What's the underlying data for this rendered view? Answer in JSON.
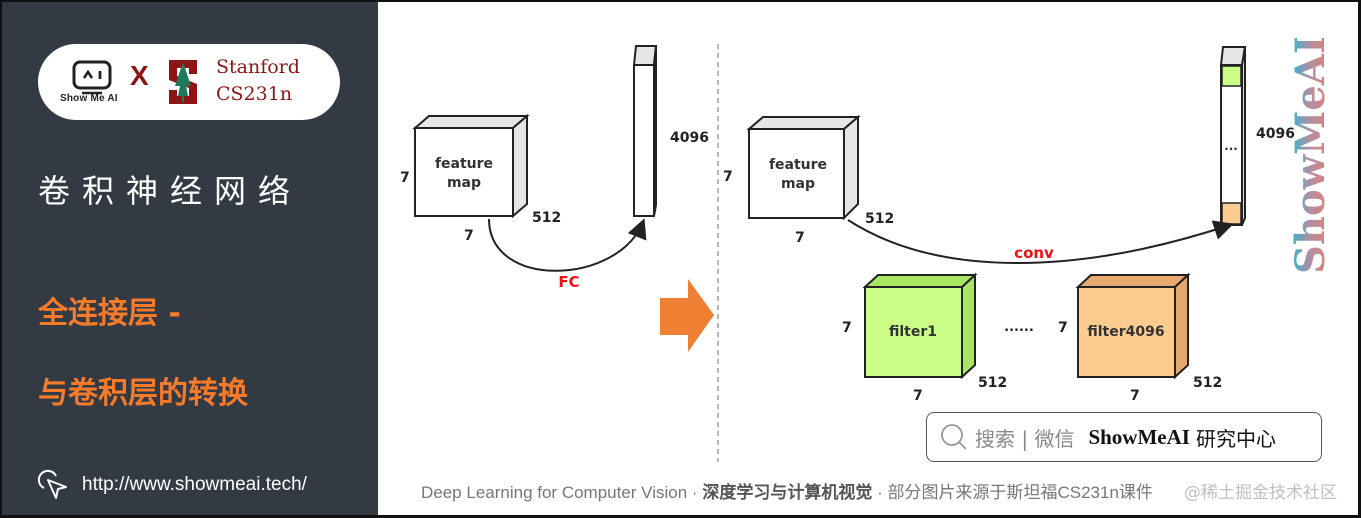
{
  "brand": {
    "showmeai_label": "Show Me AI",
    "cross": "X",
    "partner_line1": "Stanford",
    "partner_line2": "CS231n",
    "colors": {
      "stanford_red": "#8c1515",
      "panel_bg": "#333a44",
      "accent_orange": "#f47b2a"
    }
  },
  "left_panel": {
    "course_title": "卷积神经网络",
    "topic_line1": "全连接层 -",
    "topic_line2": "与卷积层的转换",
    "url": "http://www.showmeai.tech/"
  },
  "diagram": {
    "left_side": {
      "feature_map_label_line1": "feature",
      "feature_map_label_line2": "map",
      "height_dim": "7",
      "width_dim": "7",
      "depth_dim": "512",
      "vector_dim": "4096",
      "operation_label": "FC"
    },
    "right_side": {
      "feature_map_label_line1": "feature",
      "feature_map_label_line2": "map",
      "height_dim": "7",
      "width_dim": "7",
      "depth_dim": "512",
      "vector_dim": "4096",
      "vector_ellipsis": "...",
      "operation_label": "conv",
      "filters": [
        {
          "label": "filter1",
          "height_dim": "7",
          "width_dim": "7",
          "depth_dim": "512",
          "color": "#ccff88"
        },
        {
          "label": "filter4096",
          "height_dim": "7",
          "width_dim": "7",
          "depth_dim": "512",
          "color": "#ffcc8f"
        }
      ],
      "filters_ellipsis": "......"
    },
    "transition_arrow_color": "#ef7f32",
    "operation_label_color": "#ee1111"
  },
  "watermark_vertical": "ShowMeAI",
  "search_box": {
    "hint": "搜索 | 微信",
    "brand": "ShowMeAI",
    "brand_suffix": "研究中心"
  },
  "footer": {
    "course_en": "Deep Learning for Computer Vision",
    "separator": "·",
    "course_cn": "深度学习与计算机视觉",
    "source_note": "部分图片来源于斯坦福CS231n课件",
    "overlay_watermark": "@稀土掘金技术社区"
  }
}
